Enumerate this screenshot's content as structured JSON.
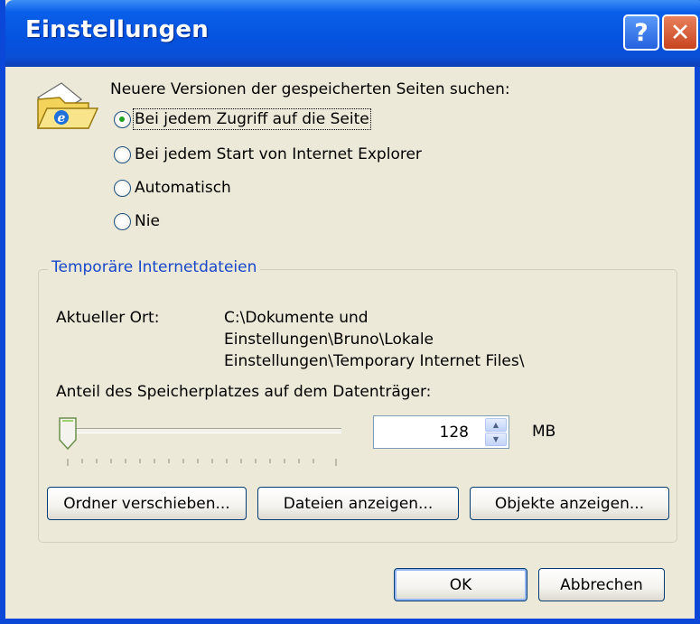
{
  "window": {
    "title": "Einstellungen",
    "help_label": "?",
    "close_label": "✕"
  },
  "check": {
    "label": "Neuere Versionen der gespeicherten Seiten suchen:",
    "options": [
      {
        "label": "Bei jedem Zugriff auf die Seite",
        "checked": true
      },
      {
        "label": "Bei jedem Start von Internet Explorer",
        "checked": false
      },
      {
        "label": "Automatisch",
        "checked": false
      },
      {
        "label": "Nie",
        "checked": false
      }
    ]
  },
  "temp": {
    "group_label": "Temporäre Internetdateien",
    "location_label": "Aktueller Ort:",
    "location_lines": [
      "C:\\Dokumente und",
      "Einstellungen\\Bruno\\Lokale",
      "Einstellungen\\Temporary Internet Files\\"
    ],
    "disk_label": "Anteil des Speicherplatzes auf dem Datenträger:",
    "disk_value": "128",
    "disk_unit": "MB",
    "slider_level": 0.0
  },
  "buttons": {
    "move_folder": "Ordner verschieben...",
    "view_files": "Dateien anzeigen...",
    "view_objects": "Objekte anzeigen...",
    "ok": "OK",
    "cancel": "Abbrechen"
  },
  "colors": {
    "titlebar": "#0553e0",
    "dialog_bg": "#ece9d8",
    "group_label": "#1848c8",
    "radio_dot": "#21a121"
  }
}
